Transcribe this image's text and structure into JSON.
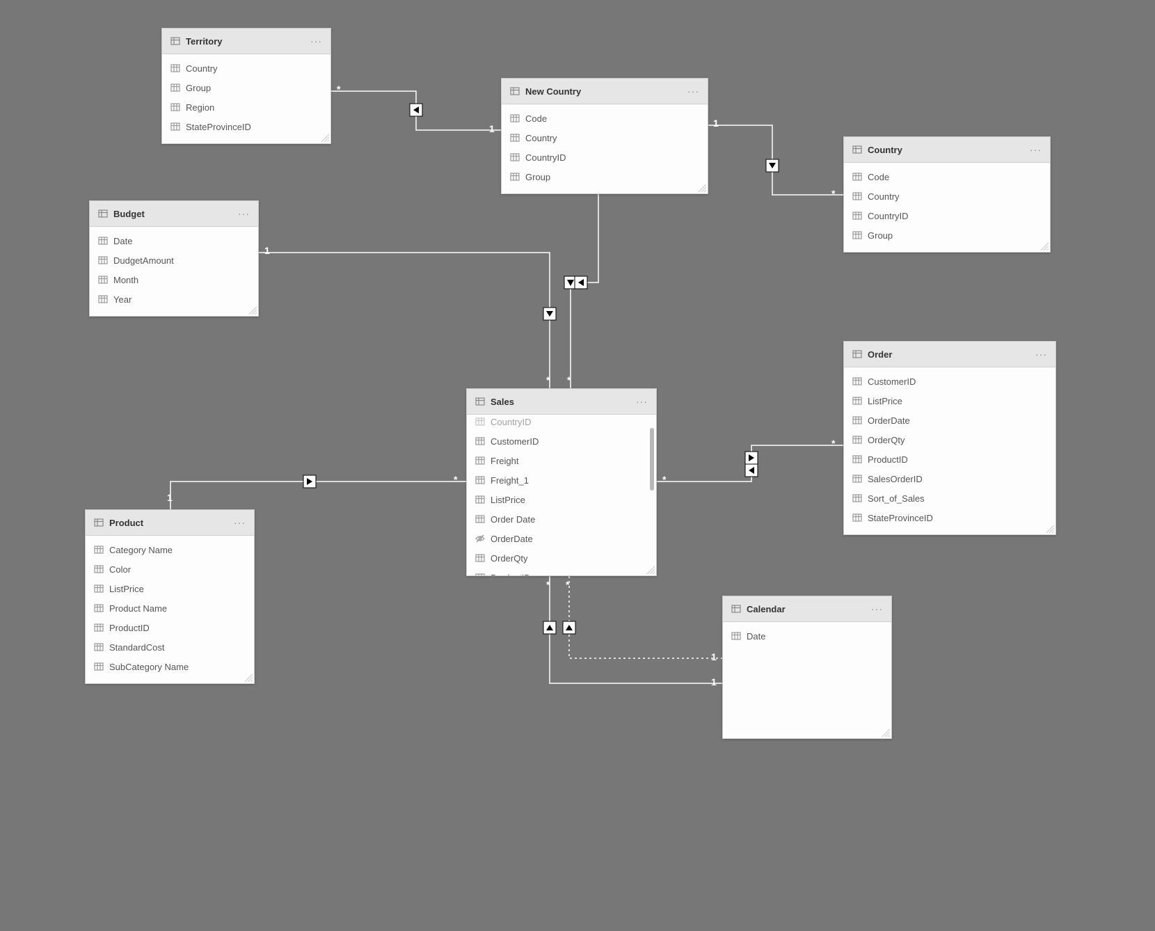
{
  "tables": {
    "territory": {
      "title": "Territory",
      "fields": [
        "Country",
        "Group",
        "Region",
        "StateProvinceID"
      ]
    },
    "budget": {
      "title": "Budget",
      "fields": [
        "Date",
        "DudgetAmount",
        "Month",
        "Year"
      ]
    },
    "new_country": {
      "title": "New Country",
      "fields": [
        "Code",
        "Country",
        "CountryID",
        "Group"
      ]
    },
    "country": {
      "title": "Country",
      "fields": [
        "Code",
        "Country",
        "CountryID",
        "Group"
      ]
    },
    "sales": {
      "title": "Sales",
      "fields": [
        "CountryID",
        "CustomerID",
        "Freight",
        "Freight_1",
        "ListPrice",
        "Order Date",
        "OrderDate",
        "OrderQty",
        "ProductID"
      ],
      "hidden_index": 6
    },
    "order": {
      "title": "Order",
      "fields": [
        "CustomerID",
        "ListPrice",
        "OrderDate",
        "OrderQty",
        "ProductID",
        "SalesOrderID",
        "Sort_of_Sales",
        "StateProvinceID"
      ]
    },
    "product": {
      "title": "Product",
      "fields": [
        "Category Name",
        "Color",
        "ListPrice",
        "Product Name",
        "ProductID",
        "StandardCost",
        "SubCategory Name"
      ]
    },
    "calendar": {
      "title": "Calendar",
      "fields": [
        "Date"
      ]
    }
  },
  "cardinality": {
    "one": "1",
    "many": "*"
  },
  "relationships": [
    {
      "from": "sales",
      "to": "territory",
      "from_card": "*",
      "to_card": "1",
      "filter_dir": "single"
    },
    {
      "from": "sales",
      "to": "new_country",
      "from_card": "*",
      "to_card": "1",
      "filter_dir": "single"
    },
    {
      "from": "sales",
      "to": "budget",
      "from_card": "*",
      "to_card": "1",
      "filter_dir": "single"
    },
    {
      "from": "sales",
      "to": "product",
      "from_card": "*",
      "to_card": "1",
      "filter_dir": "single"
    },
    {
      "from": "sales",
      "to": "order",
      "from_card": "*",
      "to_card": "*",
      "filter_dir": "both"
    },
    {
      "from": "sales",
      "to": "calendar",
      "from_card": "*",
      "to_card": "1",
      "filter_dir": "single",
      "active": true
    },
    {
      "from": "sales",
      "to": "calendar",
      "from_card": "*",
      "to_card": "1",
      "filter_dir": "single",
      "active": false
    },
    {
      "from": "country",
      "to": "new_country",
      "from_card": "*",
      "to_card": "1",
      "filter_dir": "single"
    }
  ]
}
